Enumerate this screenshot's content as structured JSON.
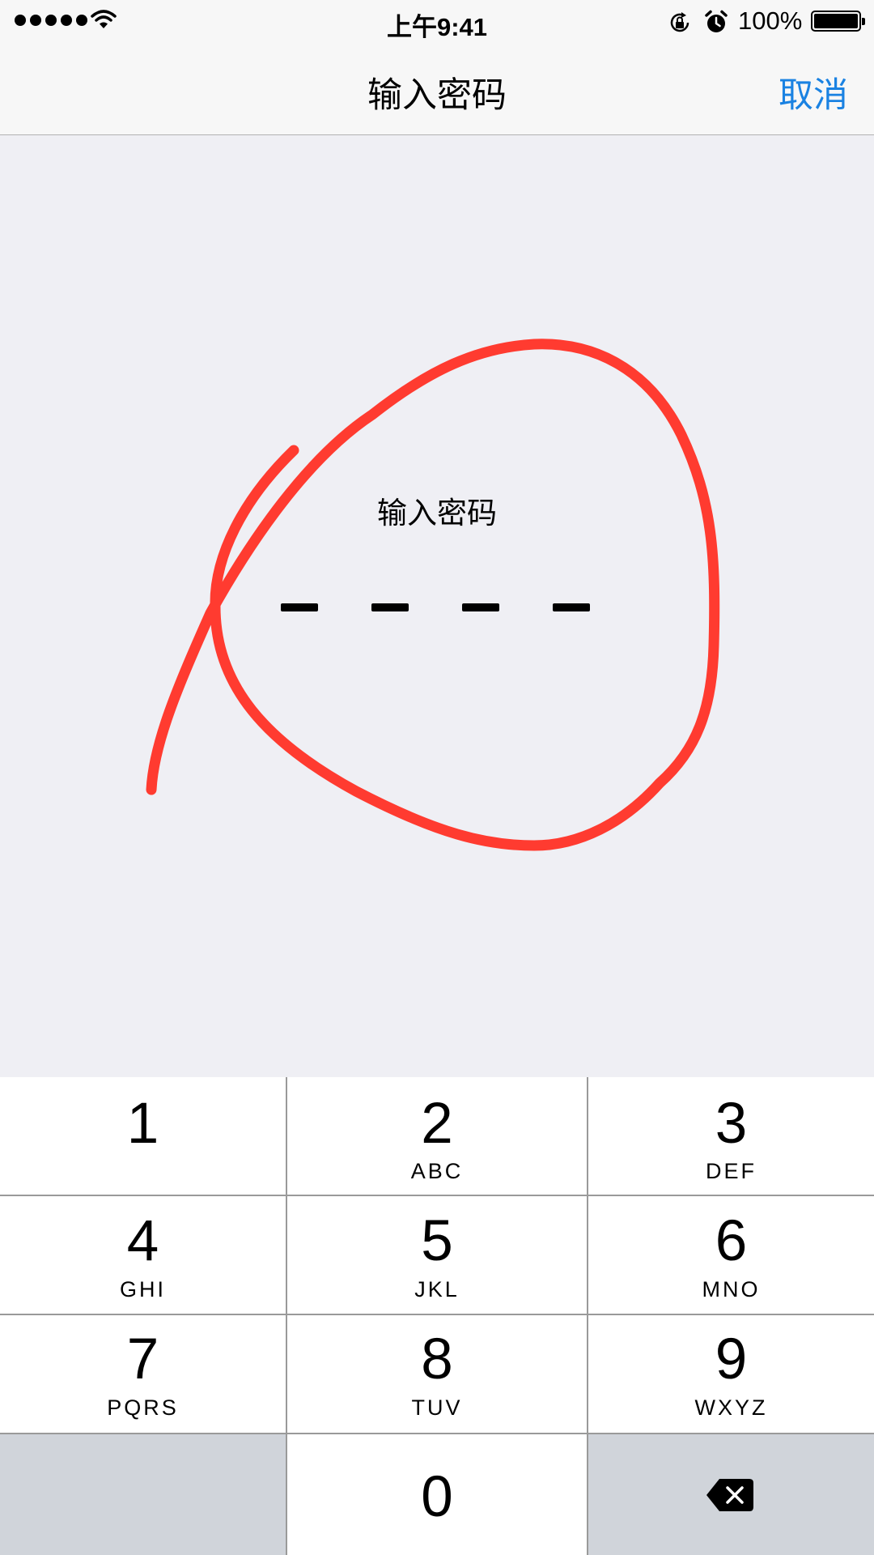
{
  "status_bar": {
    "signal_dots": 5,
    "time": "上午9:41",
    "battery_pct": "100%",
    "battery_level": 1.0,
    "icons": [
      "signal-icon",
      "wifi-icon",
      "rotation-lock-icon",
      "alarm-icon",
      "battery-icon"
    ]
  },
  "nav": {
    "title": "输入密码",
    "cancel_label": "取消"
  },
  "passcode": {
    "prompt": "输入密码",
    "digits_total": 4,
    "digits_entered": 0
  },
  "keypad": {
    "keys": [
      {
        "num": "1",
        "letters": ""
      },
      {
        "num": "2",
        "letters": "ABC"
      },
      {
        "num": "3",
        "letters": "DEF"
      },
      {
        "num": "4",
        "letters": "GHI"
      },
      {
        "num": "5",
        "letters": "JKL"
      },
      {
        "num": "6",
        "letters": "MNO"
      },
      {
        "num": "7",
        "letters": "PQRS"
      },
      {
        "num": "8",
        "letters": "TUV"
      },
      {
        "num": "9",
        "letters": "WXYZ"
      },
      {
        "num": "0",
        "letters": ""
      }
    ],
    "backspace_icon": "backspace-icon"
  },
  "colors": {
    "accent": "#1a82e2",
    "background": "#efeff4",
    "annotation": "#ff3b30",
    "keypad_dark_key": "#d0d4da"
  }
}
